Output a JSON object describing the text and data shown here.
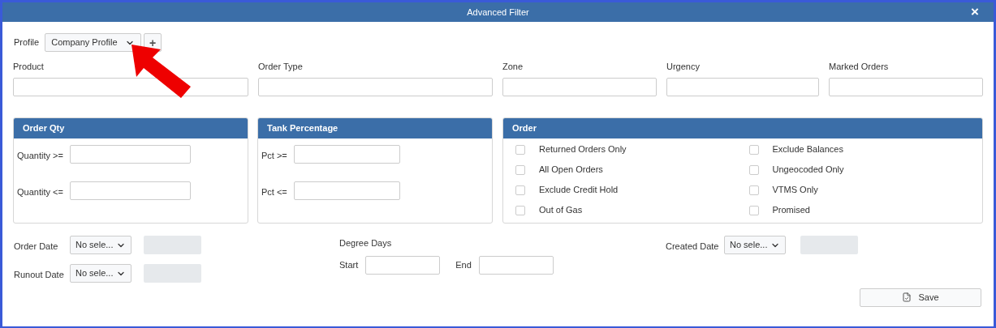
{
  "window": {
    "title": "Advanced Filter",
    "close": "×"
  },
  "profile": {
    "label": "Profile",
    "value": "Company Profile",
    "add": "+"
  },
  "filters": [
    {
      "label": "Product"
    },
    {
      "label": "Order Type"
    },
    {
      "label": "Zone"
    },
    {
      "label": "Urgency"
    },
    {
      "label": "Marked Orders"
    }
  ],
  "order_qty": {
    "title": "Order Qty",
    "fields": [
      {
        "label": "Quantity >="
      },
      {
        "label": "Quantity <="
      }
    ]
  },
  "tank_percentage": {
    "title": "Tank Percentage",
    "fields": [
      {
        "label": "Pct >="
      },
      {
        "label": "Pct <="
      }
    ]
  },
  "order": {
    "title": "Order",
    "options": [
      {
        "label": "Returned Orders Only",
        "checked": false
      },
      {
        "label": "Exclude Balances",
        "checked": false
      },
      {
        "label": "All Open Orders",
        "checked": false
      },
      {
        "label": "Ungeocoded Only",
        "checked": false
      },
      {
        "label": "Exclude Credit Hold",
        "checked": false
      },
      {
        "label": "VTMS Only",
        "checked": false
      },
      {
        "label": "Out of Gas",
        "checked": false
      },
      {
        "label": "Promised",
        "checked": false
      }
    ]
  },
  "dates": [
    {
      "label": "Order Date",
      "select": "No sele..."
    },
    {
      "label": "Runout Date",
      "select": "No sele..."
    }
  ],
  "degree_days": {
    "title": "Degree Days",
    "start": "Start",
    "end": "End"
  },
  "created_date": {
    "label": "Created Date",
    "select": "No sele..."
  },
  "save_button": "Save"
}
